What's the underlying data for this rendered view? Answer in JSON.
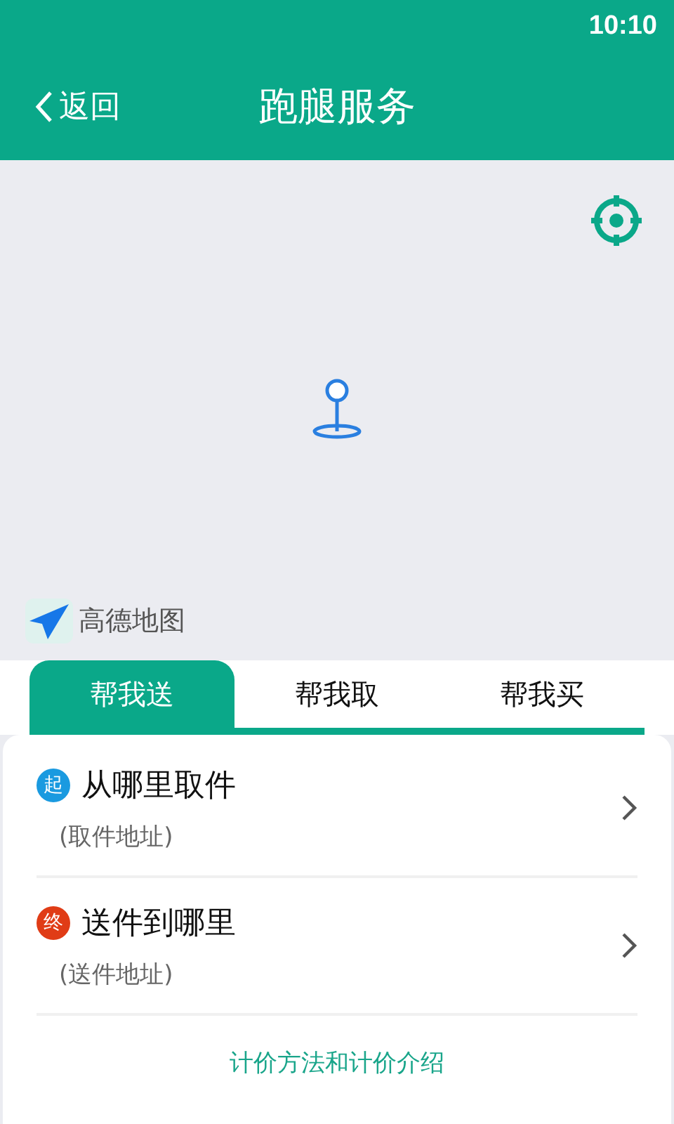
{
  "status_bar": {
    "time": "10:10"
  },
  "header": {
    "back": "返回",
    "title": "跑腿服务"
  },
  "map": {
    "logo": "高德地图"
  },
  "tabs": [
    {
      "label": "帮我送",
      "selected": true
    },
    {
      "label": "帮我取",
      "selected": false
    },
    {
      "label": "帮我买",
      "selected": false
    }
  ],
  "addresses": [
    {
      "badge": "起",
      "kind": "start",
      "title": "从哪里取件",
      "hint": "(取件地址)"
    },
    {
      "badge": "终",
      "kind": "end",
      "title": "送件到哪里",
      "hint": "(送件地址)"
    }
  ],
  "pricing_link": "计价方法和计价介绍"
}
